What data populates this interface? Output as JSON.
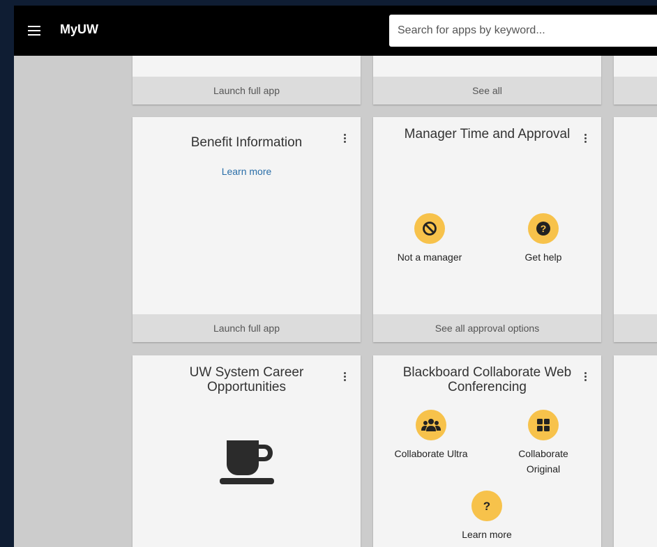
{
  "header": {
    "app_name": "MyUW",
    "search_placeholder": "Search for apps by keyword..."
  },
  "row1": {
    "card1_footer": "Launch full app",
    "card2_footer": "See all"
  },
  "benefit_card": {
    "title": "Benefit Information",
    "link": "Learn more",
    "footer": "Launch full app"
  },
  "manager_card": {
    "title": "Manager Time and Approval",
    "tiles": [
      {
        "label": "Not a manager",
        "icon": "block-icon"
      },
      {
        "label": "Get help",
        "icon": "help-icon"
      }
    ],
    "footer": "See all approval options"
  },
  "career_card": {
    "title": "UW System Career Opportunities",
    "icon": "coffee-cup-icon"
  },
  "collab_card": {
    "title": "Blackboard Collaborate Web Conferencing",
    "tiles": [
      {
        "label": "Collaborate Ultra",
        "icon": "group-icon"
      },
      {
        "label": "Collaborate Original",
        "icon": "grid-icon"
      },
      {
        "label": "Learn more",
        "icon": "question-icon"
      }
    ]
  },
  "colors": {
    "accent_yellow": "#f7c24b",
    "top_bar": "#000000",
    "link_blue": "#2a6ea8",
    "card_bg": "#f4f4f4",
    "footer_bg": "#dcdcdc"
  }
}
